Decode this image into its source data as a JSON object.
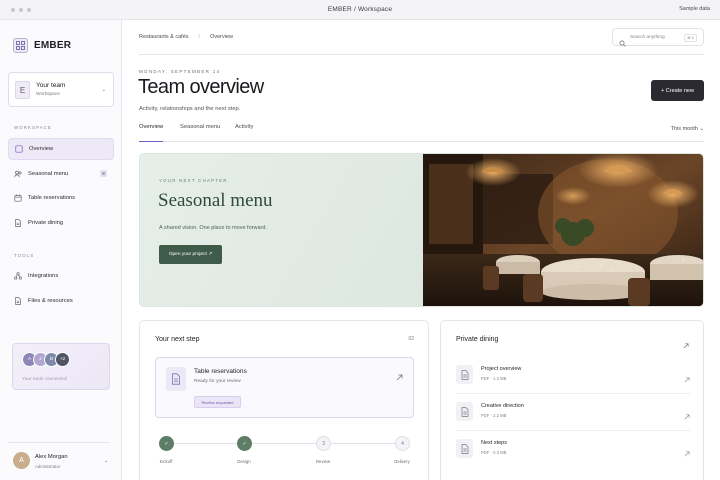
{
  "window": {
    "title": "EMBER / Workspace",
    "sample_label": "Sample data"
  },
  "sidebar": {
    "brand": "EMBER",
    "team": {
      "initial": "E",
      "name": "Your team",
      "sub": "Workspace"
    },
    "workspace_label": "WORKSPACE",
    "items": [
      {
        "label": "Overview",
        "icon": "square-icon",
        "active": true
      },
      {
        "label": "Seasonal menu",
        "icon": "people-icon",
        "badge": "8"
      },
      {
        "label": "Table reservations",
        "icon": "calendar-icon"
      },
      {
        "label": "Private dining",
        "icon": "document-icon"
      }
    ],
    "tools_label": "TOOLS",
    "tools": [
      {
        "label": "Integrations",
        "icon": "nodes-icon"
      },
      {
        "label": "Files & resources",
        "icon": "document-icon"
      }
    ],
    "connect": {
      "avatars": [
        "A",
        "J",
        "B",
        "+2"
      ],
      "avatar_colors": [
        "#8f86b8",
        "#b0a6cf",
        "#7e8aa7",
        "#4e5564"
      ],
      "text": "Your tools connected"
    },
    "user": {
      "initial": "A",
      "name": "Alex Morgan",
      "role": "Administrator"
    }
  },
  "header": {
    "breadcrumbs": [
      "Restaurants & cafés",
      "Overview"
    ],
    "search_placeholder": "Search anything",
    "search_shortcut": "⌘ K",
    "date": "MONDAY, SEPTEMBER 14",
    "title": "Team overview",
    "subtitle": "Activity, relationships and the next step.",
    "create_label": "+ Create new"
  },
  "tabs": {
    "items": [
      "Overview",
      "Seasonal menu",
      "Activity"
    ],
    "active_index": 0,
    "period": "This month ⌄"
  },
  "hero": {
    "eyebrow": "YOUR NEXT CHAPTER",
    "title": "Seasonal menu",
    "text": "A shared vision. One place to move forward.",
    "button": "Open your project ↗"
  },
  "next_step": {
    "title": "Your next step",
    "count": "02",
    "task": {
      "title": "Table reservations",
      "sub": "Ready for your review",
      "chip": "Review requested"
    },
    "steps": [
      {
        "label": "Kickoff",
        "state": "done",
        "mark": "✓"
      },
      {
        "label": "Design",
        "state": "done",
        "mark": "✓"
      },
      {
        "label": "Review",
        "state": "todo",
        "mark": "3"
      },
      {
        "label": "Delivery",
        "state": "todo",
        "mark": "4"
      }
    ]
  },
  "private_dining": {
    "title": "Private dining",
    "files": [
      {
        "title": "Project overview",
        "meta": "PDF · 1.2 MB"
      },
      {
        "title": "Creative direction",
        "meta": "PDF · 2.2 MB"
      },
      {
        "title": "Next steps",
        "meta": "PDF · 0.3 MB"
      }
    ]
  },
  "colors": {
    "accent": "#6d5ec0",
    "hero_green": "#3f5b4a",
    "dark_button": "#2b2a30"
  }
}
